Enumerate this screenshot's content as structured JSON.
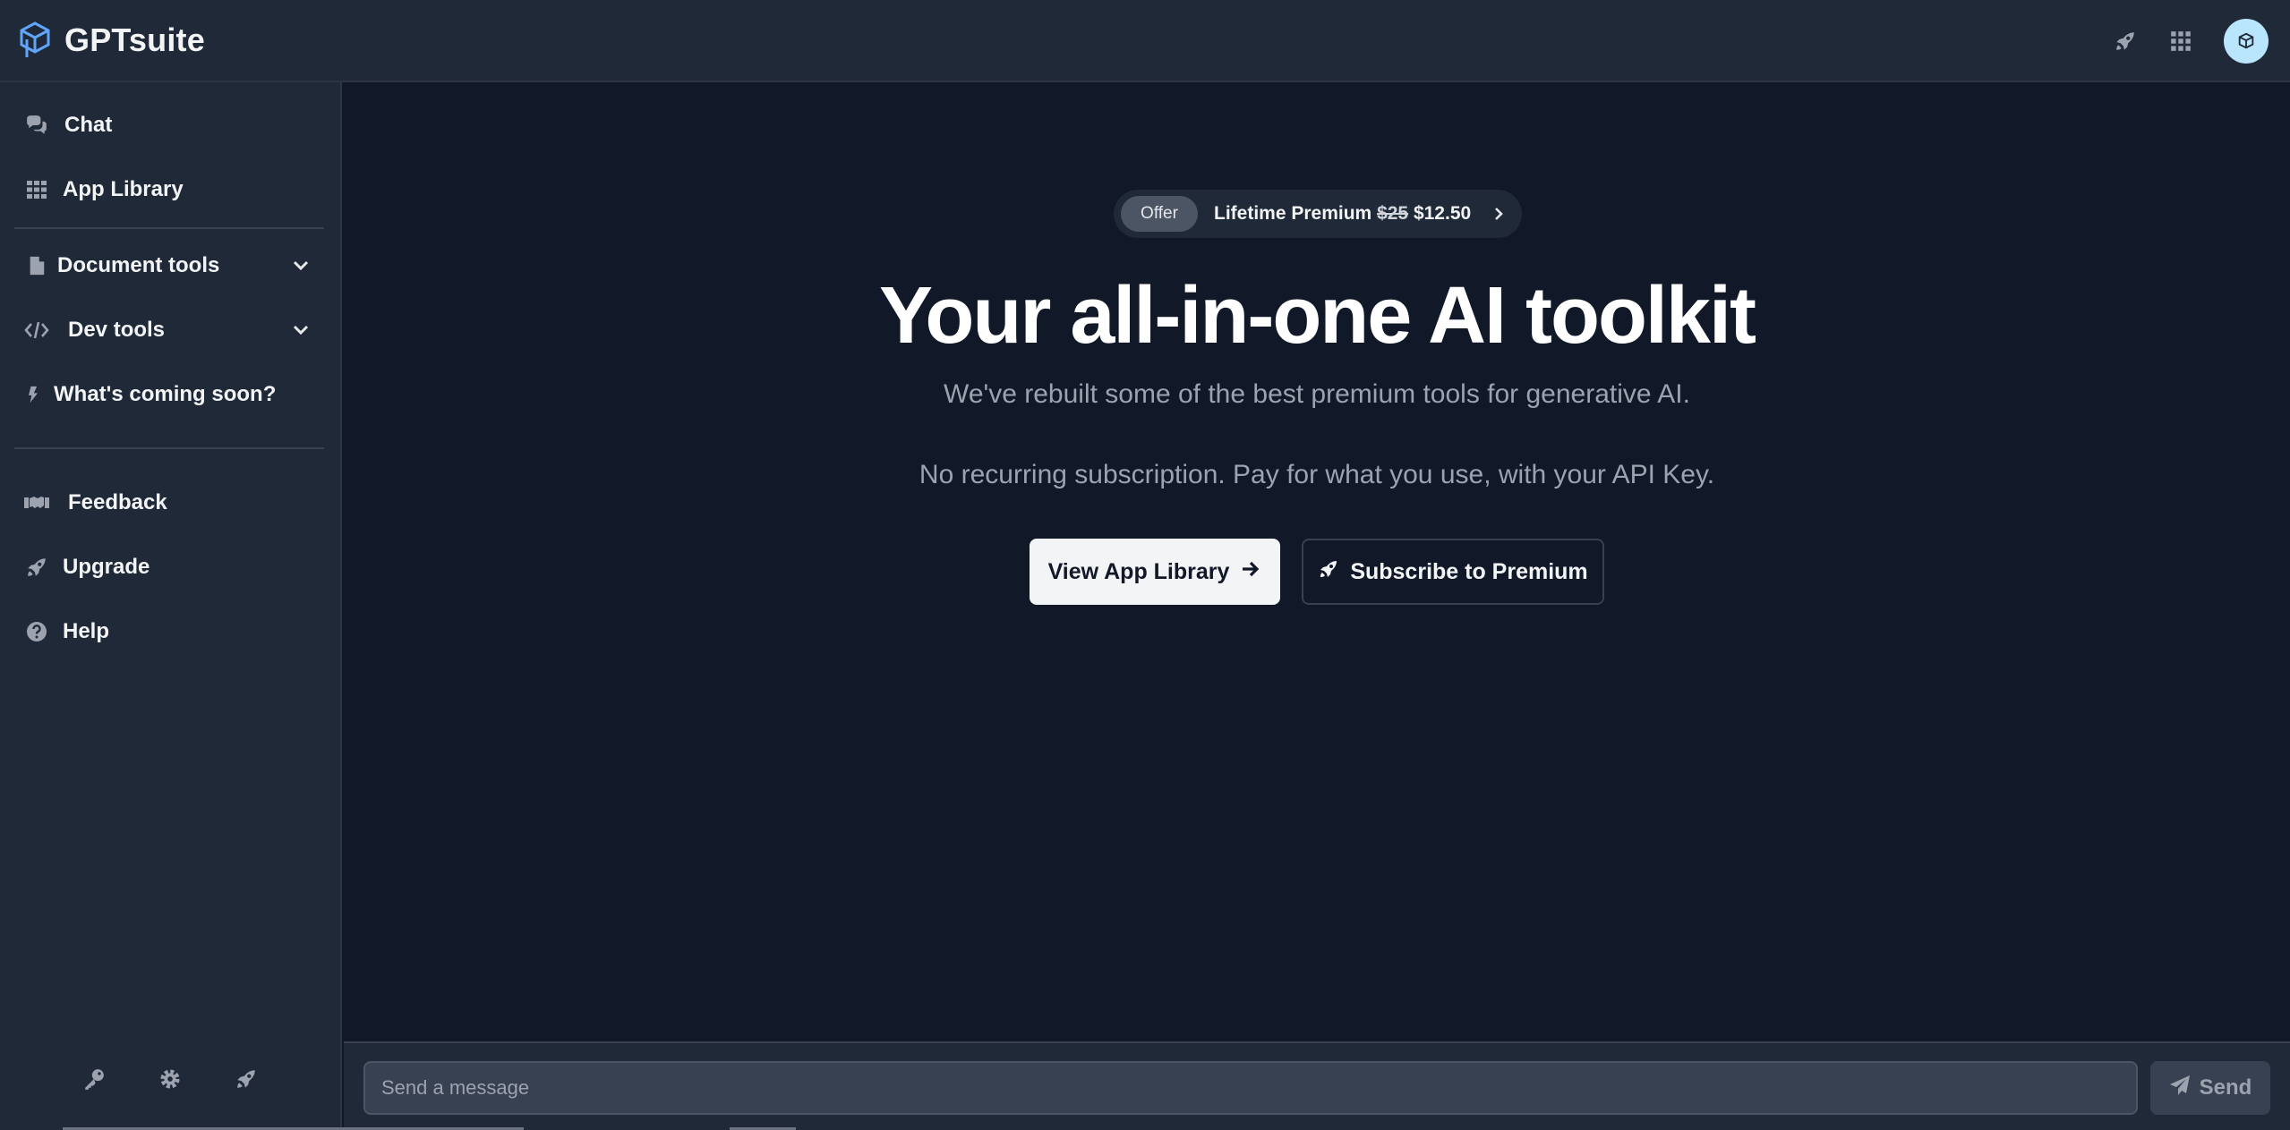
{
  "app": {
    "name": "GPTsuite"
  },
  "sidebar": {
    "items": [
      {
        "label": "Chat",
        "icon": "chat-icon"
      },
      {
        "label": "App Library",
        "icon": "grid-icon"
      },
      {
        "label": "Document tools",
        "icon": "document-icon"
      },
      {
        "label": "Dev tools",
        "icon": "code-icon"
      },
      {
        "label": "What's coming soon?",
        "icon": "bolt-icon"
      },
      {
        "label": "Feedback",
        "icon": "handshake-icon"
      },
      {
        "label": "Upgrade",
        "icon": "rocket-icon"
      },
      {
        "label": "Help",
        "icon": "help-icon"
      }
    ],
    "bottom_icons": [
      "key-icon",
      "gear-icon",
      "rocket-icon"
    ]
  },
  "offer": {
    "pill": "Offer",
    "label": "Lifetime Premium",
    "old_price": "$25",
    "new_price": "$12.50"
  },
  "hero": {
    "title": "Your all-in-one AI toolkit",
    "subtitle": "We've rebuilt some of the best premium tools for generative AI.",
    "subtitle2": "No recurring subscription. Pay for what you use, with your API Key."
  },
  "buttons": {
    "view_library": "View App Library",
    "subscribe": "Subscribe to Premium"
  },
  "composer": {
    "placeholder": "Send a message",
    "send_label": "Send"
  },
  "colors": {
    "background": "#111827",
    "panel": "#1f2937",
    "accent_avatar": "#bae6fd"
  }
}
